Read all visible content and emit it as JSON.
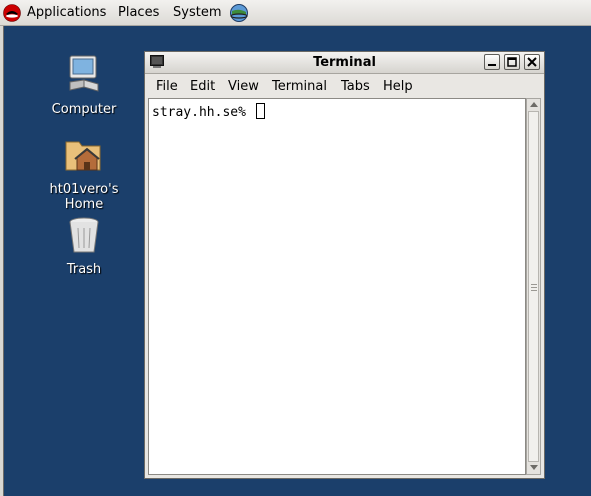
{
  "panel": {
    "menus": [
      "Applications",
      "Places",
      "System"
    ]
  },
  "desktop": {
    "icons": [
      {
        "label": "Computer",
        "icon": "computer-icon"
      },
      {
        "label": "ht01vero's Home",
        "icon": "home-folder-icon"
      },
      {
        "label": "Trash",
        "icon": "trash-icon"
      }
    ]
  },
  "terminal": {
    "title": "Terminal",
    "menu": [
      "File",
      "Edit",
      "View",
      "Terminal",
      "Tabs",
      "Help"
    ],
    "prompt": "stray.hh.se%"
  },
  "colors": {
    "desktop_bg": "#1b3f6b",
    "panel_bg": "#dcdad5",
    "window_bg": "#e9e7e3"
  }
}
